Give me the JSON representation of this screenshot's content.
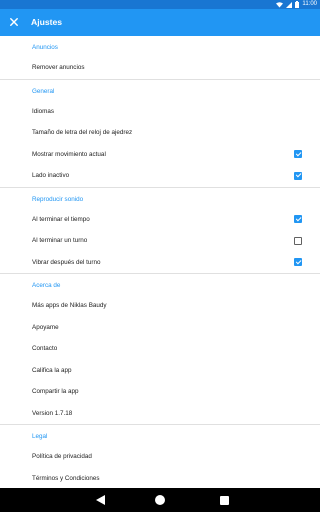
{
  "status_bar": {
    "time": "11:00",
    "icons": [
      "wifi-icon",
      "signal-icon",
      "battery-icon"
    ]
  },
  "toolbar": {
    "close_icon": "close-icon",
    "title": "Ajustes"
  },
  "sections": [
    {
      "title": "Anuncios",
      "items": [
        {
          "label": "Remover anuncios"
        }
      ]
    },
    {
      "title": "General",
      "items": [
        {
          "label": "Idiomas"
        },
        {
          "label": "Tamaño de letra del reloj de ajedrez"
        },
        {
          "label": "Mostrar movimiento actual",
          "checked": true
        },
        {
          "label": "Lado inactivo",
          "checked": true
        }
      ]
    },
    {
      "title": "Reproducir sonido",
      "items": [
        {
          "label": "Al terminar el tiempo",
          "checked": true
        },
        {
          "label": "Al terminar un turno",
          "checked": false
        },
        {
          "label": "Vibrar después del turno",
          "checked": true
        }
      ]
    },
    {
      "title": "Acerca de",
      "items": [
        {
          "label": "Más apps de Niklas Baudy"
        },
        {
          "label": "Apoyame"
        },
        {
          "label": "Contacto"
        },
        {
          "label": "Califica la app"
        },
        {
          "label": "Compartir la app"
        },
        {
          "label": "Version 1.7.18"
        }
      ]
    },
    {
      "title": "Legal",
      "items": [
        {
          "label": "Política de privacidad"
        },
        {
          "label": "Términos y Condiciones"
        }
      ]
    }
  ],
  "nav_bar": {
    "icons": [
      "back-icon",
      "home-icon",
      "recents-icon"
    ]
  },
  "colors": {
    "accent": "#2196f3",
    "status_bar": "#1976d2",
    "text": "#212121",
    "divider": "#e0e0e0"
  }
}
